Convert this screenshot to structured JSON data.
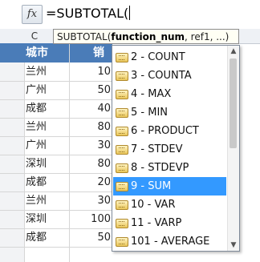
{
  "formula_bar": {
    "fx_label": "fx",
    "formula": "=SUBTOTAL("
  },
  "column_header": {
    "visible_col": "C"
  },
  "tooltip": {
    "prefix": "SUBTOTAL(",
    "bold_arg": "function_num",
    "rest": ", ref1, ...)"
  },
  "table": {
    "headers": [
      "城市",
      "销售"
    ],
    "rows": [
      {
        "city": "兰州",
        "value": "10"
      },
      {
        "city": "广州",
        "value": "50"
      },
      {
        "city": "成都",
        "value": "40"
      },
      {
        "city": "兰州",
        "value": "80"
      },
      {
        "city": "广州",
        "value": "30"
      },
      {
        "city": "深圳",
        "value": "80"
      },
      {
        "city": "成都",
        "value": "20"
      },
      {
        "city": "兰州",
        "value": "30"
      },
      {
        "city": "深圳",
        "value": "100"
      },
      {
        "city": "成都",
        "value": "50"
      }
    ]
  },
  "dropdown": {
    "items": [
      "2 - COUNT",
      "3 - COUNTA",
      "4 - MAX",
      "5 - MIN",
      "6 - PRODUCT",
      "7 - STDEV",
      "8 - STDEVP",
      "9 - SUM",
      "10 - VAR",
      "11 - VARP",
      "101 - AVERAGE"
    ],
    "selected_index": 7
  }
}
